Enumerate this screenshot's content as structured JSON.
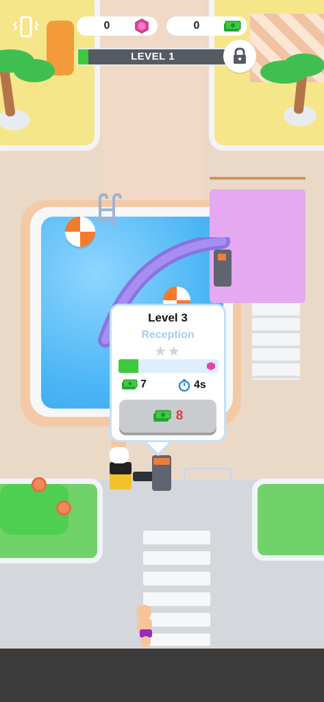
{
  "hud": {
    "gems": "0",
    "cash": "0",
    "level_label": "LEVEL 1",
    "level_progress": 0.07
  },
  "popup": {
    "title": "Level 3",
    "subtitle": "Reception",
    "stars_filled": 0,
    "stars_total": 2,
    "stars_text": "★★",
    "progress": 0.2,
    "income": "7",
    "time": "4s",
    "cost": "8"
  },
  "icons": {
    "vibration": "phone-vibrate-icon",
    "gem": "gem-icon",
    "cash": "cash-icon",
    "lock": "lock-icon",
    "timer": "stopwatch-icon"
  },
  "colors": {
    "accent_green": "#3ec93e",
    "gem_pink": "#e546a6",
    "price_red": "#e83838"
  }
}
